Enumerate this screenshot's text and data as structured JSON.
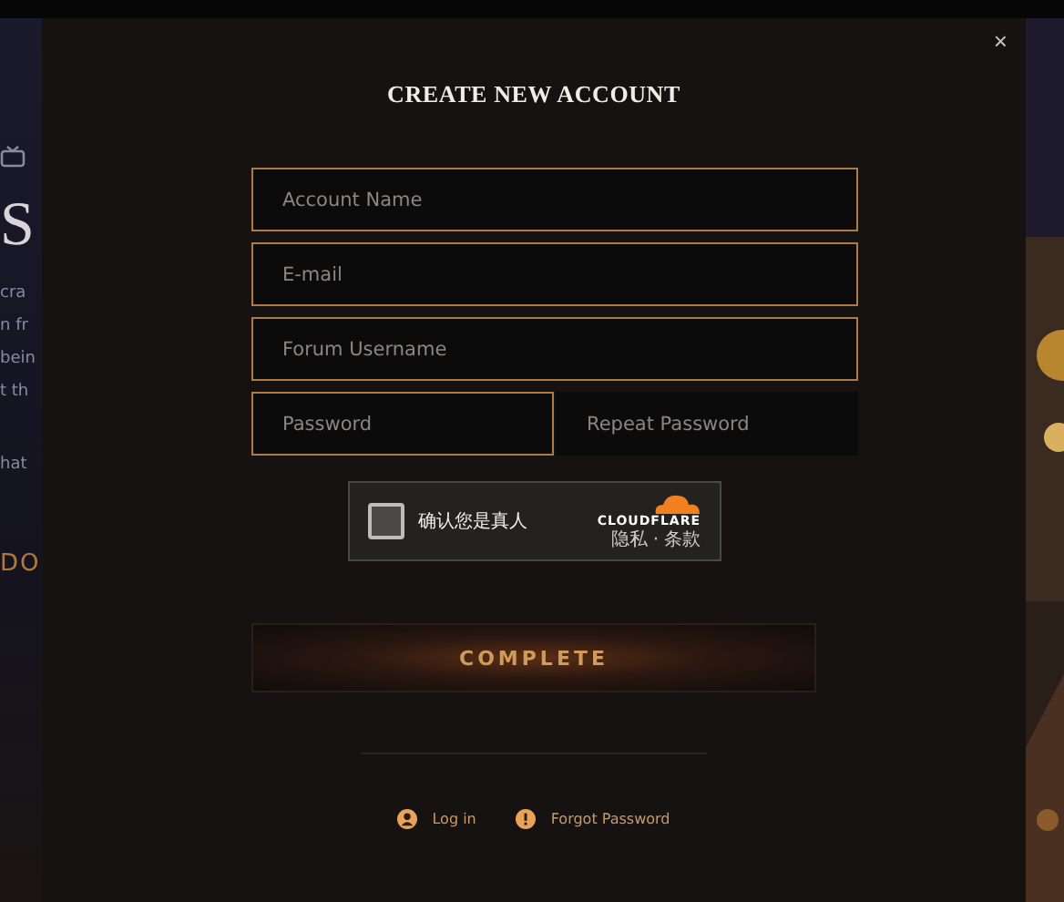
{
  "page": {
    "headline": "S",
    "lines": [
      "cra",
      "n fr",
      "bein",
      "t th"
    ],
    "line_after_gap": "hat",
    "cta": "DO"
  },
  "modal": {
    "close": "×",
    "title": "CREATE NEW ACCOUNT",
    "fields": [
      {
        "kind": "full",
        "placeholder": "Account Name",
        "highlighted": true
      },
      {
        "kind": "full",
        "placeholder": "E-mail",
        "highlighted": true
      },
      {
        "kind": "full",
        "placeholder": "Forum Username",
        "highlighted": true
      },
      {
        "kind": "half",
        "placeholder": "Password",
        "highlighted": true
      },
      {
        "kind": "half",
        "placeholder": "Repeat Password",
        "highlighted": false
      }
    ],
    "captcha": {
      "label": "确认您是真人",
      "checked": false,
      "brand": "CLOUDFLARE",
      "privacy": "隐私",
      "separator": "·",
      "terms": "条款"
    },
    "submit": "COMPLETE",
    "links": [
      {
        "kind": "login",
        "label": "Log in"
      },
      {
        "kind": "forgot",
        "label": "Forgot Password"
      }
    ]
  }
}
